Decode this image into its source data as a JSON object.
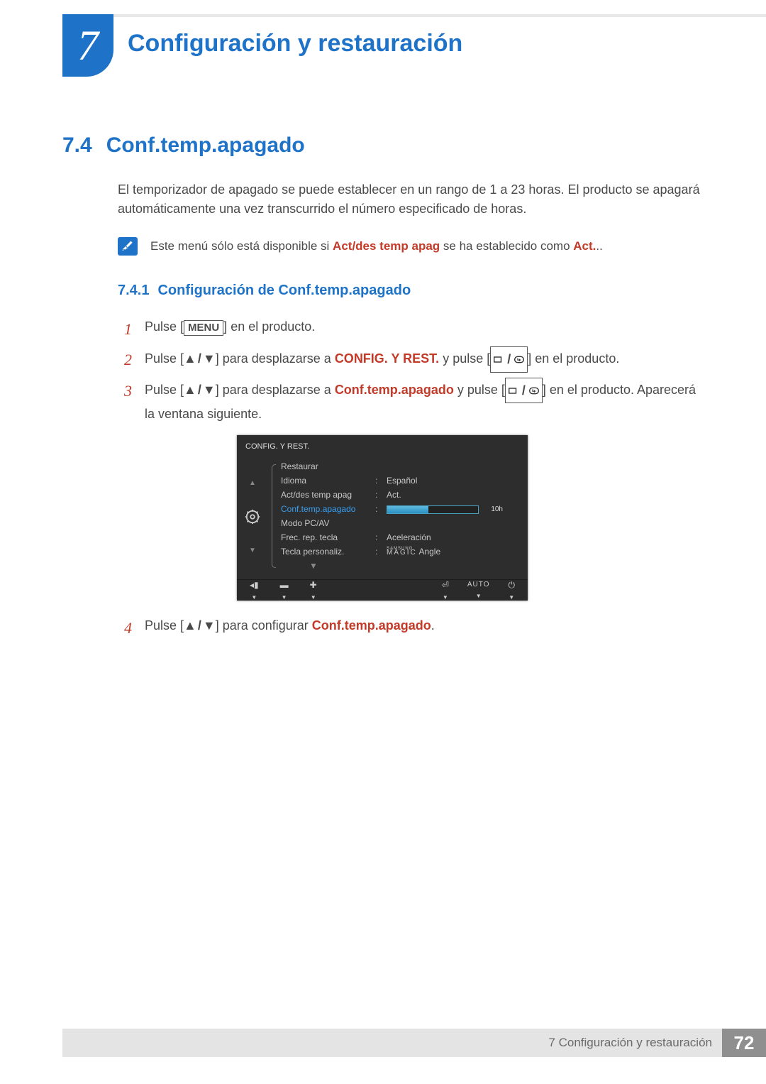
{
  "chapter": {
    "number": "7",
    "title": "Configuración y restauración"
  },
  "section": {
    "number": "7.4",
    "title": "Conf.temp.apagado"
  },
  "paragraph": "El temporizador de apagado se puede establecer en un rango de 1 a 23 horas. El producto se apagará automáticamente una vez transcurrido el número especificado de horas.",
  "note": {
    "pre": "Este menú sólo está disponible si ",
    "bold1": "Act/des temp apag",
    "mid": " se ha establecido como ",
    "bold2": "Act."
  },
  "subsection": {
    "number": "7.4.1",
    "title": "Configuración de Conf.temp.apagado"
  },
  "steps": {
    "s1": {
      "num": "1",
      "a": "Pulse [",
      "menu": "MENU",
      "b": "] en el producto."
    },
    "s2": {
      "num": "2",
      "a": "Pulse [",
      "b": "] para desplazarse a ",
      "target": "CONFIG. Y REST.",
      "c": " y pulse [",
      "d": "] en el producto."
    },
    "s3": {
      "num": "3",
      "a": "Pulse [",
      "b": "] para desplazarse a ",
      "target": "Conf.temp.apagado",
      "c": " y pulse [",
      "d": "] en el producto. Aparecerá la ventana siguiente."
    },
    "s4": {
      "num": "4",
      "a": "Pulse [",
      "b": "] para configurar ",
      "target": "Conf.temp.apagado",
      "c": "."
    }
  },
  "osd": {
    "title": "CONFIG. Y REST.",
    "rows": {
      "r0": {
        "label": "Restaurar",
        "value": ""
      },
      "r1": {
        "label": "Idioma",
        "value": "Español"
      },
      "r2": {
        "label": "Act/des temp apag",
        "value": "Act."
      },
      "r3": {
        "label": "Conf.temp.apagado",
        "value": "10h"
      },
      "r4": {
        "label": "Modo PC/AV",
        "value": ""
      },
      "r5": {
        "label": "Frec. rep. tecla",
        "value": "Aceleración"
      },
      "r6": {
        "label": "Tecla personaliz.",
        "value_small": "SAMSUNG",
        "value_main": "MAGIC",
        "value_suffix": " Angle"
      }
    },
    "bottom": {
      "auto": "AUTO"
    }
  },
  "footer": {
    "text": "7 Configuración y restauración",
    "page": "72"
  }
}
